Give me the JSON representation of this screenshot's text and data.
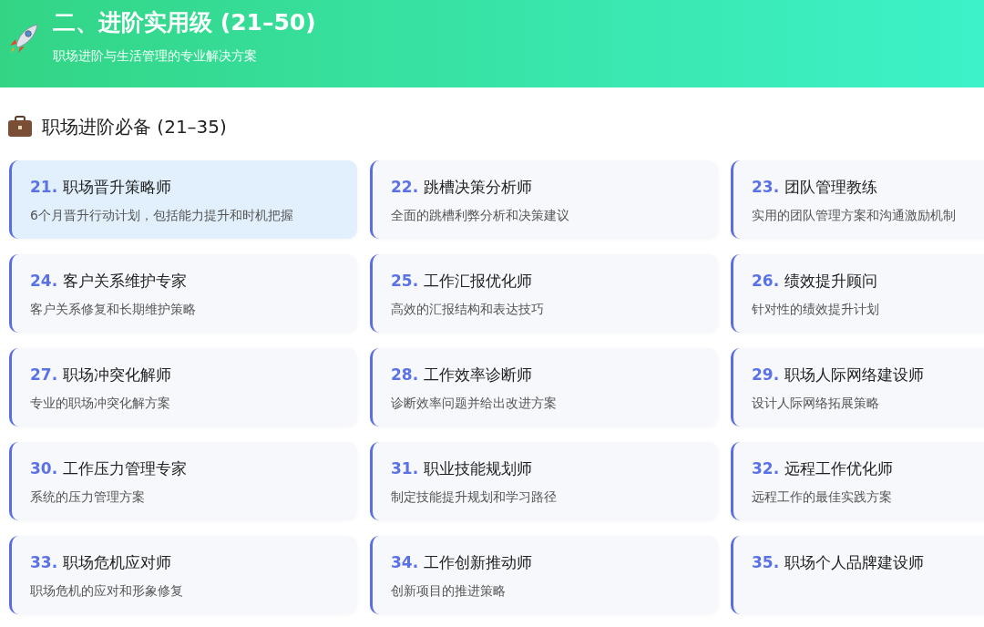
{
  "header": {
    "title": "二、进阶实用级 (21–50)",
    "subtitle": "职场进阶与生活管理的专业解决方案"
  },
  "section": {
    "title": "职场进阶必备 (21–35)"
  },
  "cards": [
    {
      "number": "21.",
      "title": "职场晋升策略师",
      "description": "6个月晋升行动计划，包括能力提升和时机把握",
      "selected": true
    },
    {
      "number": "22.",
      "title": "跳槽决策分析师",
      "description": "全面的跳槽利弊分析和决策建议",
      "selected": false
    },
    {
      "number": "23.",
      "title": "团队管理教练",
      "description": "实用的团队管理方案和沟通激励机制",
      "selected": false
    },
    {
      "number": "24.",
      "title": "客户关系维护专家",
      "description": "客户关系修复和长期维护策略",
      "selected": false
    },
    {
      "number": "25.",
      "title": "工作汇报优化师",
      "description": "高效的汇报结构和表达技巧",
      "selected": false
    },
    {
      "number": "26.",
      "title": "绩效提升顾问",
      "description": "针对性的绩效提升计划",
      "selected": false
    },
    {
      "number": "27.",
      "title": "职场冲突化解师",
      "description": "专业的职场冲突化解方案",
      "selected": false
    },
    {
      "number": "28.",
      "title": "工作效率诊断师",
      "description": "诊断效率问题并给出改进方案",
      "selected": false
    },
    {
      "number": "29.",
      "title": "职场人际网络建设师",
      "description": "设计人际网络拓展策略",
      "selected": false
    },
    {
      "number": "30.",
      "title": "工作压力管理专家",
      "description": "系统的压力管理方案",
      "selected": false
    },
    {
      "number": "31.",
      "title": "职业技能规划师",
      "description": "制定技能提升规划和学习路径",
      "selected": false
    },
    {
      "number": "32.",
      "title": "远程工作优化师",
      "description": "远程工作的最佳实践方案",
      "selected": false
    },
    {
      "number": "33.",
      "title": "职场危机应对师",
      "description": "职场危机的应对和形象修复",
      "selected": false
    },
    {
      "number": "34.",
      "title": "工作创新推动师",
      "description": "创新项目的推进策略",
      "selected": false
    },
    {
      "number": "35.",
      "title": "职场个人品牌建设师",
      "selected": false
    }
  ]
}
